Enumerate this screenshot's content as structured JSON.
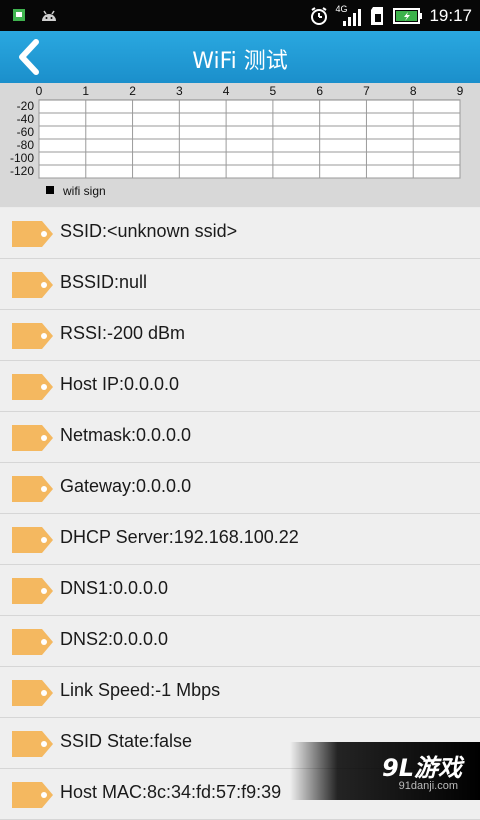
{
  "status_bar": {
    "time": "19:17",
    "network": "4G",
    "icons": [
      "sim-icon",
      "android-icon",
      "alarm-icon",
      "signal-icon",
      "sd-card-icon",
      "battery-icon"
    ]
  },
  "header": {
    "title": "WiFi 测试",
    "back_icon": "chevron-left-icon"
  },
  "chart_data": {
    "type": "line",
    "title": "",
    "x_ticks": [
      "0",
      "1",
      "2",
      "3",
      "4",
      "5",
      "6",
      "7",
      "8",
      "9"
    ],
    "y_ticks": [
      "-20",
      "-40",
      "-60",
      "-80",
      "-100",
      "-120"
    ],
    "xlim": [
      0,
      9
    ],
    "ylim": [
      -120,
      -20
    ],
    "grid": true,
    "legend": "bottom-left",
    "series": [
      {
        "name": "wifi sign",
        "values": []
      }
    ]
  },
  "info_list": [
    {
      "label": "SSID:<unknown ssid>"
    },
    {
      "label": "BSSID:null"
    },
    {
      "label": "RSSI:-200 dBm"
    },
    {
      "label": "Host IP:0.0.0.0"
    },
    {
      "label": "Netmask:0.0.0.0"
    },
    {
      "label": "Gateway:0.0.0.0"
    },
    {
      "label": "DHCP Server:192.168.100.22"
    },
    {
      "label": "DNS1:0.0.0.0"
    },
    {
      "label": "DNS2:0.0.0.0"
    },
    {
      "label": "Link Speed:-1 Mbps"
    },
    {
      "label": "SSID State:false"
    },
    {
      "label": "Host MAC:8c:34:fd:57:f9:39"
    }
  ],
  "colors": {
    "header": "#1f9ad6",
    "tag": "#f4b860",
    "chart_bg": "#d8d8d8"
  },
  "watermark": {
    "logo": "9L游戏",
    "url": "91danji.com"
  }
}
